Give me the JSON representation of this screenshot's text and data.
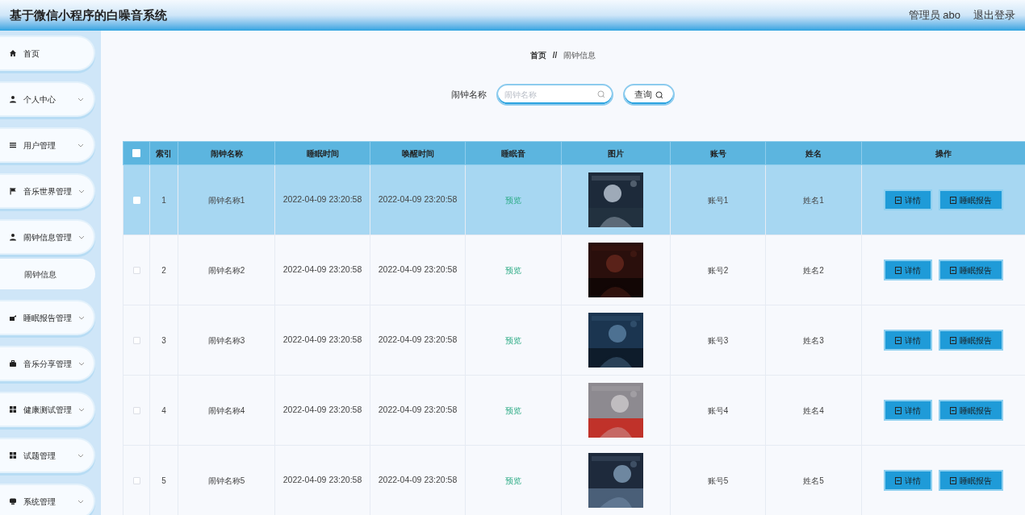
{
  "header": {
    "title": "基于微信小程序的白噪音系统",
    "user": "管理员 abo",
    "logout": "退出登录"
  },
  "sidebar": {
    "items": [
      {
        "label": "首页"
      },
      {
        "label": "个人中心",
        "kind": "group"
      },
      {
        "label": "用户管理",
        "kind": "group"
      },
      {
        "label": "音乐世界管理",
        "kind": "group"
      },
      {
        "label": "闹钟信息管理",
        "kind": "group",
        "children": [
          {
            "label": "闹钟信息"
          }
        ]
      },
      {
        "label": "睡眠报告管理",
        "kind": "group"
      },
      {
        "label": "音乐分享管理",
        "kind": "group"
      },
      {
        "label": "健康测试管理",
        "kind": "group"
      },
      {
        "label": "试题管理",
        "kind": "group"
      },
      {
        "label": "系统管理",
        "kind": "group"
      }
    ]
  },
  "breadcrumb": [
    "首页",
    "//",
    "闹钟信息"
  ],
  "search": {
    "label": "闹钟名称",
    "placeholder": "闹钟名称",
    "button": "查询"
  },
  "table": {
    "select_all_checked": false,
    "columns": [
      "索引",
      "闹钟名称",
      "睡眠时间",
      "唤醒时间",
      "睡眠音",
      "图片",
      "账号",
      "姓名",
      "操作"
    ],
    "rows": [
      {
        "highlighted": true,
        "checked": false,
        "index": "1",
        "name": "闹钟名称1",
        "sleep": "2022-04-09 23:20:58",
        "wake": "2022-04-09 23:20:58",
        "sound": "预览",
        "image": {
          "kind": "picture"
        },
        "account": "账号1",
        "person": "姓名1",
        "actions": [
          "详情",
          "睡眠报告"
        ]
      },
      {
        "highlighted": false,
        "checked": false,
        "index": "2",
        "name": "闹钟名称2",
        "sleep": "2022-04-09 23:20:58",
        "wake": "2022-04-09 23:20:58",
        "sound": "预览",
        "image": {
          "kind": "picture"
        },
        "account": "账号2",
        "person": "姓名2",
        "actions": [
          "详情",
          "睡眠报告"
        ]
      },
      {
        "highlighted": false,
        "checked": false,
        "index": "3",
        "name": "闹钟名称3",
        "sleep": "2022-04-09 23:20:58",
        "wake": "2022-04-09 23:20:58",
        "sound": "预览",
        "image": {
          "kind": "picture"
        },
        "account": "账号3",
        "person": "姓名3",
        "actions": [
          "详情",
          "睡眠报告"
        ]
      },
      {
        "highlighted": false,
        "checked": false,
        "index": "4",
        "name": "闹钟名称4",
        "sleep": "2022-04-09 23:20:58",
        "wake": "2022-04-09 23:20:58",
        "sound": "预览",
        "image": {
          "kind": "picture"
        },
        "account": "账号4",
        "person": "姓名4",
        "actions": [
          "详情",
          "睡眠报告"
        ]
      },
      {
        "highlighted": false,
        "checked": false,
        "index": "5",
        "name": "闹钟名称5",
        "sleep": "2022-04-09 23:20:58",
        "wake": "2022-04-09 23:20:58",
        "sound": "预览",
        "image": {
          "kind": "picture"
        },
        "account": "账号5",
        "person": "姓名5",
        "actions": [
          "详情",
          "睡眠报告"
        ]
      }
    ]
  }
}
